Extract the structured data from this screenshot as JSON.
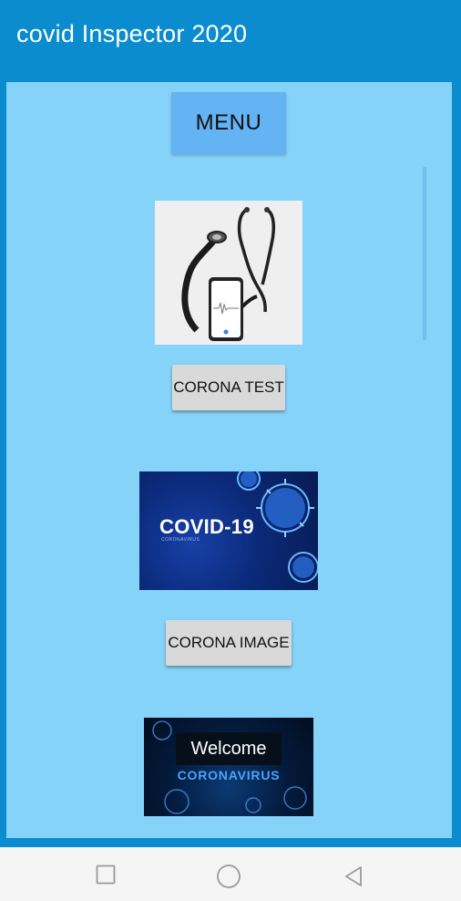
{
  "app": {
    "title": "covid Inspector 2020"
  },
  "menu": {
    "label": "MENU"
  },
  "buttons": {
    "corona_test": "CORONA TEST",
    "corona_image": "CORONA IMAGE"
  },
  "images": {
    "covid_banner_text": "COVID-19",
    "covid_banner_sub": "CORONAVIRUS",
    "welcome_text": "Welcome",
    "coronavirus_text": "CORONAVIRUS"
  },
  "colors": {
    "app_bar": "#0a8ccf",
    "panel": "#86d3f9",
    "menu_button": "#64b3f3",
    "button": "#d9d9d9"
  },
  "navigation": {
    "recent_icon": "square-icon",
    "home_icon": "circle-icon",
    "back_icon": "triangle-back-icon"
  }
}
